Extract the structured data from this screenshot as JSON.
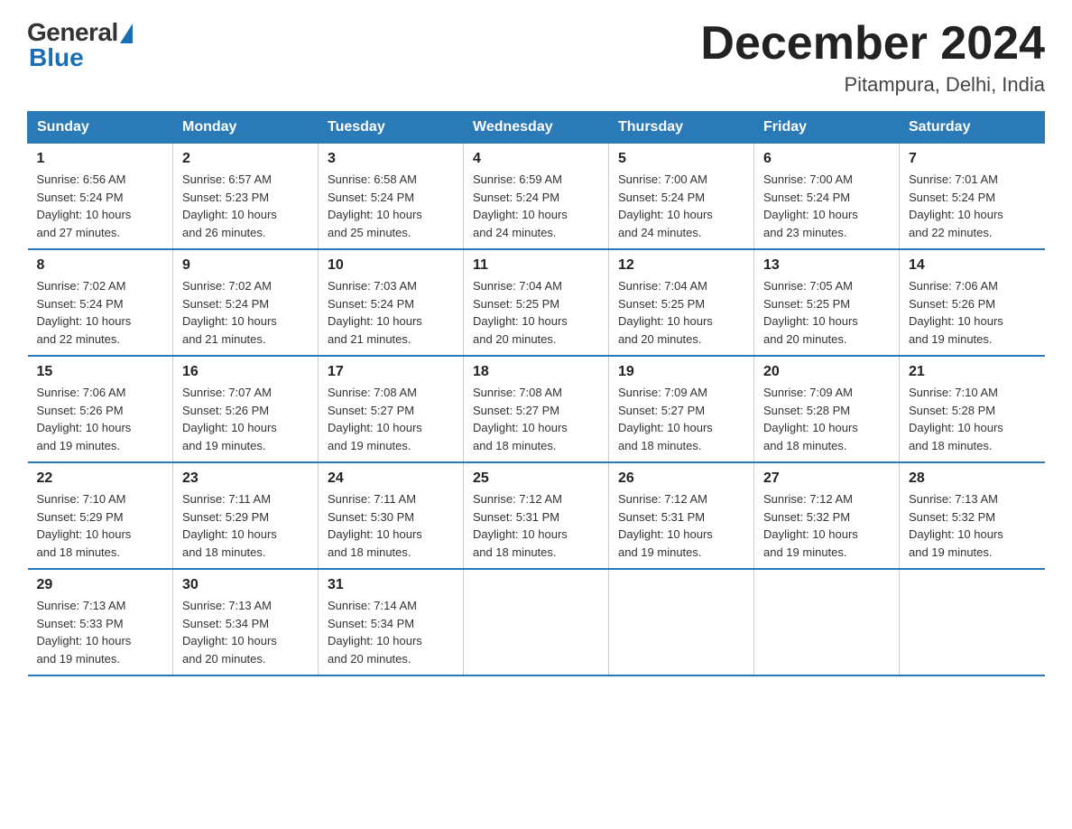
{
  "logo": {
    "general": "General",
    "blue": "Blue"
  },
  "title": "December 2024",
  "location": "Pitampura, Delhi, India",
  "days_of_week": [
    "Sunday",
    "Monday",
    "Tuesday",
    "Wednesday",
    "Thursday",
    "Friday",
    "Saturday"
  ],
  "weeks": [
    [
      {
        "day": "1",
        "sunrise": "6:56 AM",
        "sunset": "5:24 PM",
        "daylight": "10 hours and 27 minutes."
      },
      {
        "day": "2",
        "sunrise": "6:57 AM",
        "sunset": "5:23 PM",
        "daylight": "10 hours and 26 minutes."
      },
      {
        "day": "3",
        "sunrise": "6:58 AM",
        "sunset": "5:24 PM",
        "daylight": "10 hours and 25 minutes."
      },
      {
        "day": "4",
        "sunrise": "6:59 AM",
        "sunset": "5:24 PM",
        "daylight": "10 hours and 24 minutes."
      },
      {
        "day": "5",
        "sunrise": "7:00 AM",
        "sunset": "5:24 PM",
        "daylight": "10 hours and 24 minutes."
      },
      {
        "day": "6",
        "sunrise": "7:00 AM",
        "sunset": "5:24 PM",
        "daylight": "10 hours and 23 minutes."
      },
      {
        "day": "7",
        "sunrise": "7:01 AM",
        "sunset": "5:24 PM",
        "daylight": "10 hours and 22 minutes."
      }
    ],
    [
      {
        "day": "8",
        "sunrise": "7:02 AM",
        "sunset": "5:24 PM",
        "daylight": "10 hours and 22 minutes."
      },
      {
        "day": "9",
        "sunrise": "7:02 AM",
        "sunset": "5:24 PM",
        "daylight": "10 hours and 21 minutes."
      },
      {
        "day": "10",
        "sunrise": "7:03 AM",
        "sunset": "5:24 PM",
        "daylight": "10 hours and 21 minutes."
      },
      {
        "day": "11",
        "sunrise": "7:04 AM",
        "sunset": "5:25 PM",
        "daylight": "10 hours and 20 minutes."
      },
      {
        "day": "12",
        "sunrise": "7:04 AM",
        "sunset": "5:25 PM",
        "daylight": "10 hours and 20 minutes."
      },
      {
        "day": "13",
        "sunrise": "7:05 AM",
        "sunset": "5:25 PM",
        "daylight": "10 hours and 20 minutes."
      },
      {
        "day": "14",
        "sunrise": "7:06 AM",
        "sunset": "5:26 PM",
        "daylight": "10 hours and 19 minutes."
      }
    ],
    [
      {
        "day": "15",
        "sunrise": "7:06 AM",
        "sunset": "5:26 PM",
        "daylight": "10 hours and 19 minutes."
      },
      {
        "day": "16",
        "sunrise": "7:07 AM",
        "sunset": "5:26 PM",
        "daylight": "10 hours and 19 minutes."
      },
      {
        "day": "17",
        "sunrise": "7:08 AM",
        "sunset": "5:27 PM",
        "daylight": "10 hours and 19 minutes."
      },
      {
        "day": "18",
        "sunrise": "7:08 AM",
        "sunset": "5:27 PM",
        "daylight": "10 hours and 18 minutes."
      },
      {
        "day": "19",
        "sunrise": "7:09 AM",
        "sunset": "5:27 PM",
        "daylight": "10 hours and 18 minutes."
      },
      {
        "day": "20",
        "sunrise": "7:09 AM",
        "sunset": "5:28 PM",
        "daylight": "10 hours and 18 minutes."
      },
      {
        "day": "21",
        "sunrise": "7:10 AM",
        "sunset": "5:28 PM",
        "daylight": "10 hours and 18 minutes."
      }
    ],
    [
      {
        "day": "22",
        "sunrise": "7:10 AM",
        "sunset": "5:29 PM",
        "daylight": "10 hours and 18 minutes."
      },
      {
        "day": "23",
        "sunrise": "7:11 AM",
        "sunset": "5:29 PM",
        "daylight": "10 hours and 18 minutes."
      },
      {
        "day": "24",
        "sunrise": "7:11 AM",
        "sunset": "5:30 PM",
        "daylight": "10 hours and 18 minutes."
      },
      {
        "day": "25",
        "sunrise": "7:12 AM",
        "sunset": "5:31 PM",
        "daylight": "10 hours and 18 minutes."
      },
      {
        "day": "26",
        "sunrise": "7:12 AM",
        "sunset": "5:31 PM",
        "daylight": "10 hours and 19 minutes."
      },
      {
        "day": "27",
        "sunrise": "7:12 AM",
        "sunset": "5:32 PM",
        "daylight": "10 hours and 19 minutes."
      },
      {
        "day": "28",
        "sunrise": "7:13 AM",
        "sunset": "5:32 PM",
        "daylight": "10 hours and 19 minutes."
      }
    ],
    [
      {
        "day": "29",
        "sunrise": "7:13 AM",
        "sunset": "5:33 PM",
        "daylight": "10 hours and 19 minutes."
      },
      {
        "day": "30",
        "sunrise": "7:13 AM",
        "sunset": "5:34 PM",
        "daylight": "10 hours and 20 minutes."
      },
      {
        "day": "31",
        "sunrise": "7:14 AM",
        "sunset": "5:34 PM",
        "daylight": "10 hours and 20 minutes."
      },
      null,
      null,
      null,
      null
    ]
  ],
  "labels": {
    "sunrise": "Sunrise:",
    "sunset": "Sunset:",
    "daylight": "Daylight:"
  }
}
